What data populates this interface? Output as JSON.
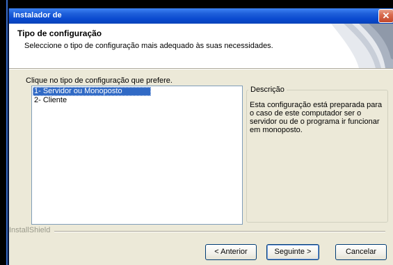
{
  "window": {
    "title": "Instalador de"
  },
  "header": {
    "title": "Tipo de configuração",
    "subtitle": "Seleccione o tipo de configuração mais adequado às suas necessidades."
  },
  "main": {
    "prompt": "Clique no tipo de configuração que prefere.",
    "options": [
      {
        "label": "1- Servidor ou Monoposto",
        "selected": true
      },
      {
        "label": "2- Cliente",
        "selected": false
      }
    ],
    "description": {
      "legend": "Descrição",
      "text": "Esta configuração está preparada para o caso de este computador ser o servidor ou de o programa ir funcionar em monoposto."
    }
  },
  "footer": {
    "brand": "InstallShield",
    "back_label": "< Anterior",
    "next_label": "Seguinte >",
    "cancel_label": "Cancelar"
  },
  "colors": {
    "titlebar": "#0a4ad0",
    "selection": "#316ac5",
    "close": "#c2472b"
  },
  "icons": {
    "close": "close-icon",
    "header_graphic": "installshield-header-graphic"
  }
}
